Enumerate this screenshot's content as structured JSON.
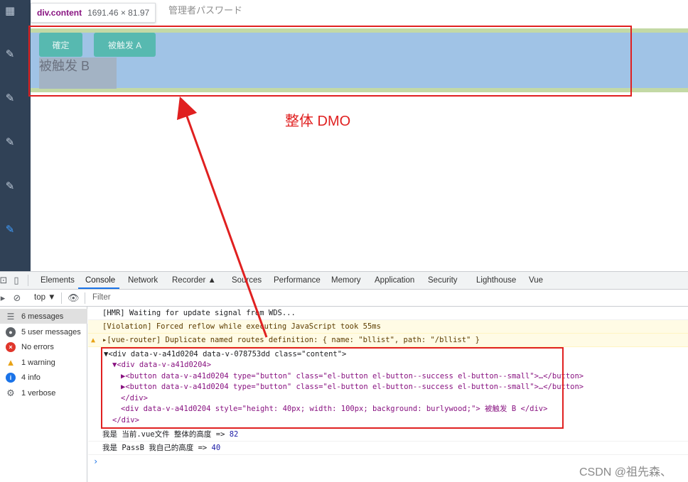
{
  "tooltip": {
    "tag": "div.content",
    "size": "1691.46 × 81.97"
  },
  "page_title": "管理者パスワード",
  "buttons": {
    "confirm": "確定",
    "trigger_a": "被触发 A"
  },
  "div_b_text": "被触发 B",
  "annotation": "整体 DMO",
  "devtools": {
    "tabs": [
      "Elements",
      "Console",
      "Network",
      "Recorder ▲",
      "Sources",
      "Performance",
      "Memory",
      "Application",
      "Security",
      "Lighthouse",
      "Vue"
    ],
    "active_tab": "Console",
    "context": "top ▼",
    "filter_placeholder": "Filter"
  },
  "sidebar_filters": [
    {
      "label": "6 messages",
      "icon": "list-icon"
    },
    {
      "label": "5 user messages",
      "icon": "user-icon"
    },
    {
      "label": "No errors",
      "icon": "error-icon"
    },
    {
      "label": "1 warning",
      "icon": "warning-icon"
    },
    {
      "label": "4 info",
      "icon": "info-icon"
    },
    {
      "label": "1 verbose",
      "icon": "gear-icon"
    }
  ],
  "console": {
    "line1": "[HMR] Waiting for update signal from WDS...",
    "line2": "[Violation] Forced reflow while executing JavaScript took 55ms",
    "line3": "▸[vue-router] Duplicate named routes definition: { name: \"bllist\", path: \"/bllist\" }",
    "tree": {
      "l1": "▼<div data-v-a41d0204 data-v-078753dd class=\"content\">",
      "l2": "▼<div data-v-a41d0204>",
      "l3": "▶<button data-v-a41d0204 type=\"button\" class=\"el-button el-button--success el-button--small\">…</button>",
      "l4": "▶<button data-v-a41d0204 type=\"button\" class=\"el-button el-button--success el-button--small\">…</button>",
      "l5": "</div>",
      "l6": "<div data-v-a41d0204 style=\"height: 40px; width: 100px; background: burlywood;\"> 被触发 B </div>",
      "l7": "</div>"
    },
    "log1_text": "我是 当前.vue文件 整体的高度 =>",
    "log1_value": "82",
    "log2_text": "我是 PassB 我自己的高度 =>",
    "log2_value": "40",
    "prompt": "›"
  },
  "watermark": "CSDN @祖先森、",
  "colors": {
    "sidebar": "#304156",
    "highlight": "#a0c3e6",
    "margin": "#c3d9a5",
    "button": "#57b9b0",
    "annotation": "#e02020"
  }
}
